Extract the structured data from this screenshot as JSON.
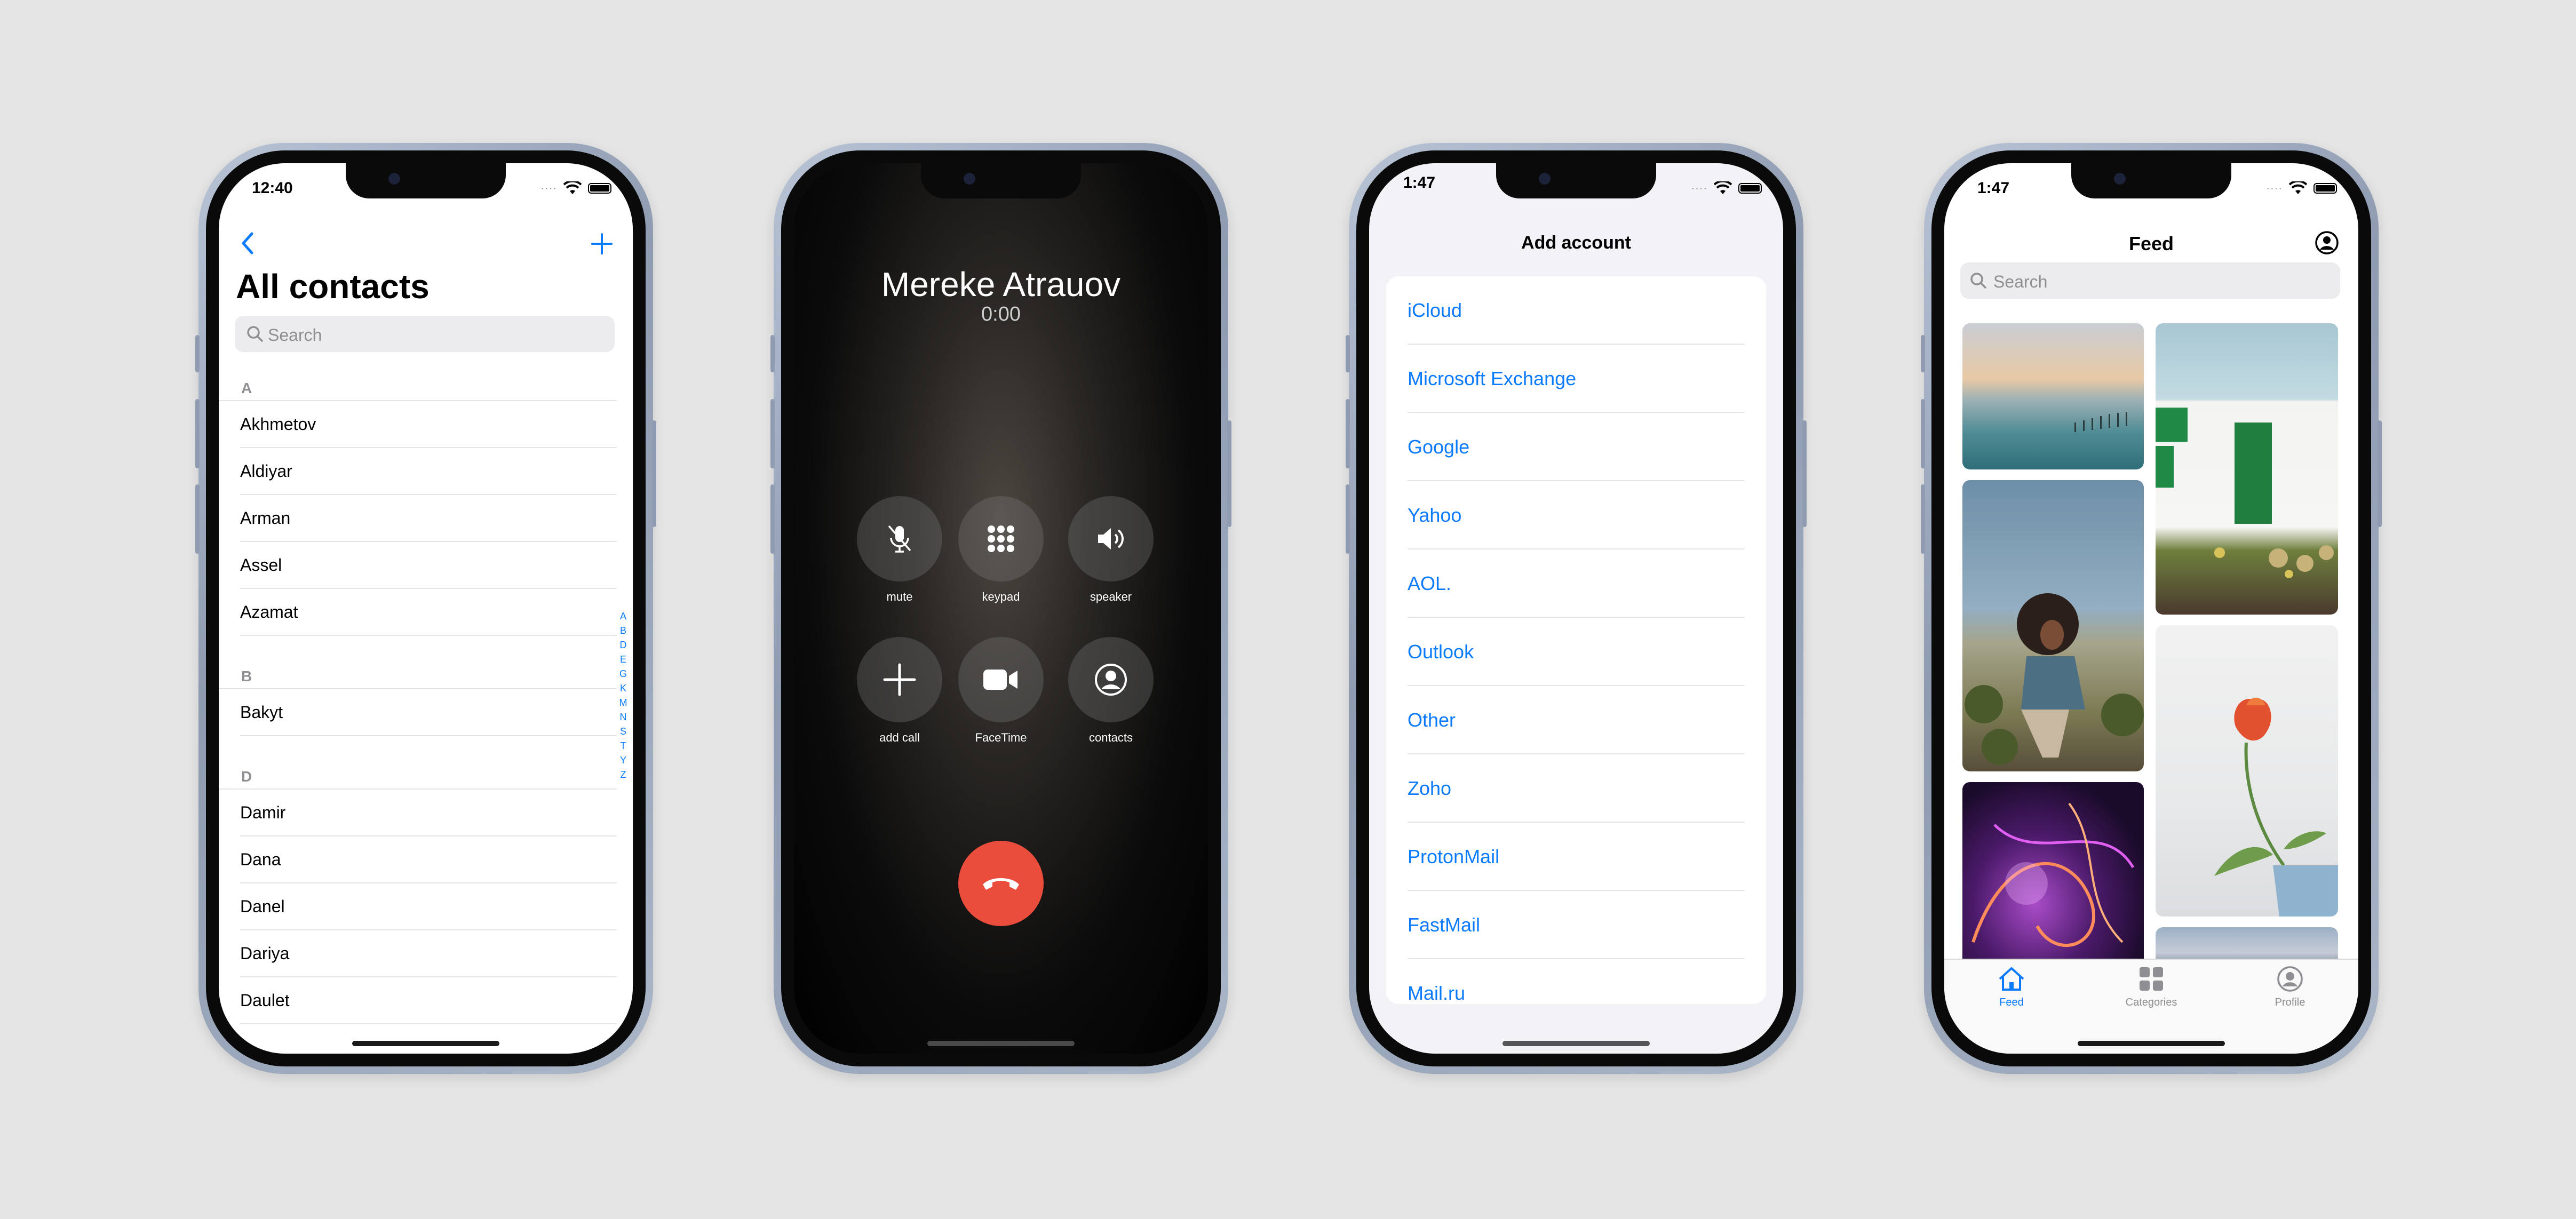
{
  "contacts_screen": {
    "time": "12:40",
    "title": "All contacts",
    "search_placeholder": "Search",
    "sections": [
      {
        "letter": "A",
        "contacts": [
          "Akhmetov",
          "Aldiyar",
          "Arman",
          "Assel",
          "Azamat"
        ]
      },
      {
        "letter": "B",
        "contacts": [
          "Bakyt"
        ]
      },
      {
        "letter": "D",
        "contacts": [
          "Damir",
          "Dana",
          "Danel",
          "Dariya",
          "Daulet"
        ]
      }
    ],
    "index_letters": [
      "A",
      "B",
      "D",
      "E",
      "G",
      "K",
      "M",
      "N",
      "S",
      "T",
      "Y",
      "Z"
    ],
    "accent_color": "#0a7aff"
  },
  "call_screen": {
    "caller_name": "Mereke Atrauov",
    "duration": "0:00",
    "buttons": [
      {
        "label": "mute",
        "icon": "mic-off-icon"
      },
      {
        "label": "keypad",
        "icon": "keypad-icon"
      },
      {
        "label": "speaker",
        "icon": "speaker-icon"
      },
      {
        "label": "add call",
        "icon": "plus-icon"
      },
      {
        "label": "FaceTime",
        "icon": "video-icon"
      },
      {
        "label": "contacts",
        "icon": "person-circle-icon"
      }
    ],
    "end_button_color": "#eb4d3d"
  },
  "accounts_screen": {
    "time": "1:47",
    "title": "Add account",
    "providers": [
      "iCloud",
      "Microsoft Exchange",
      "Google",
      "Yahoo",
      "AOL.",
      "Outlook",
      "Other",
      "Zoho",
      "ProtonMail",
      "FastMail",
      "Mail.ru"
    ]
  },
  "feed_screen": {
    "time": "1:47",
    "title": "Feed",
    "search_placeholder": "Search",
    "tabs": [
      {
        "label": "Feed",
        "icon": "house-icon",
        "active": true
      },
      {
        "label": "Categories",
        "icon": "grid-icon",
        "active": false
      },
      {
        "label": "Profile",
        "icon": "person-circle-icon",
        "active": false
      }
    ],
    "tiles": [
      "sea-pier-photo",
      "white-house-green-door-photo",
      "woman-curly-hair-photo",
      "tulip-in-cup-photo",
      "neon-light-swirl-photo",
      "coastline-photo"
    ]
  }
}
